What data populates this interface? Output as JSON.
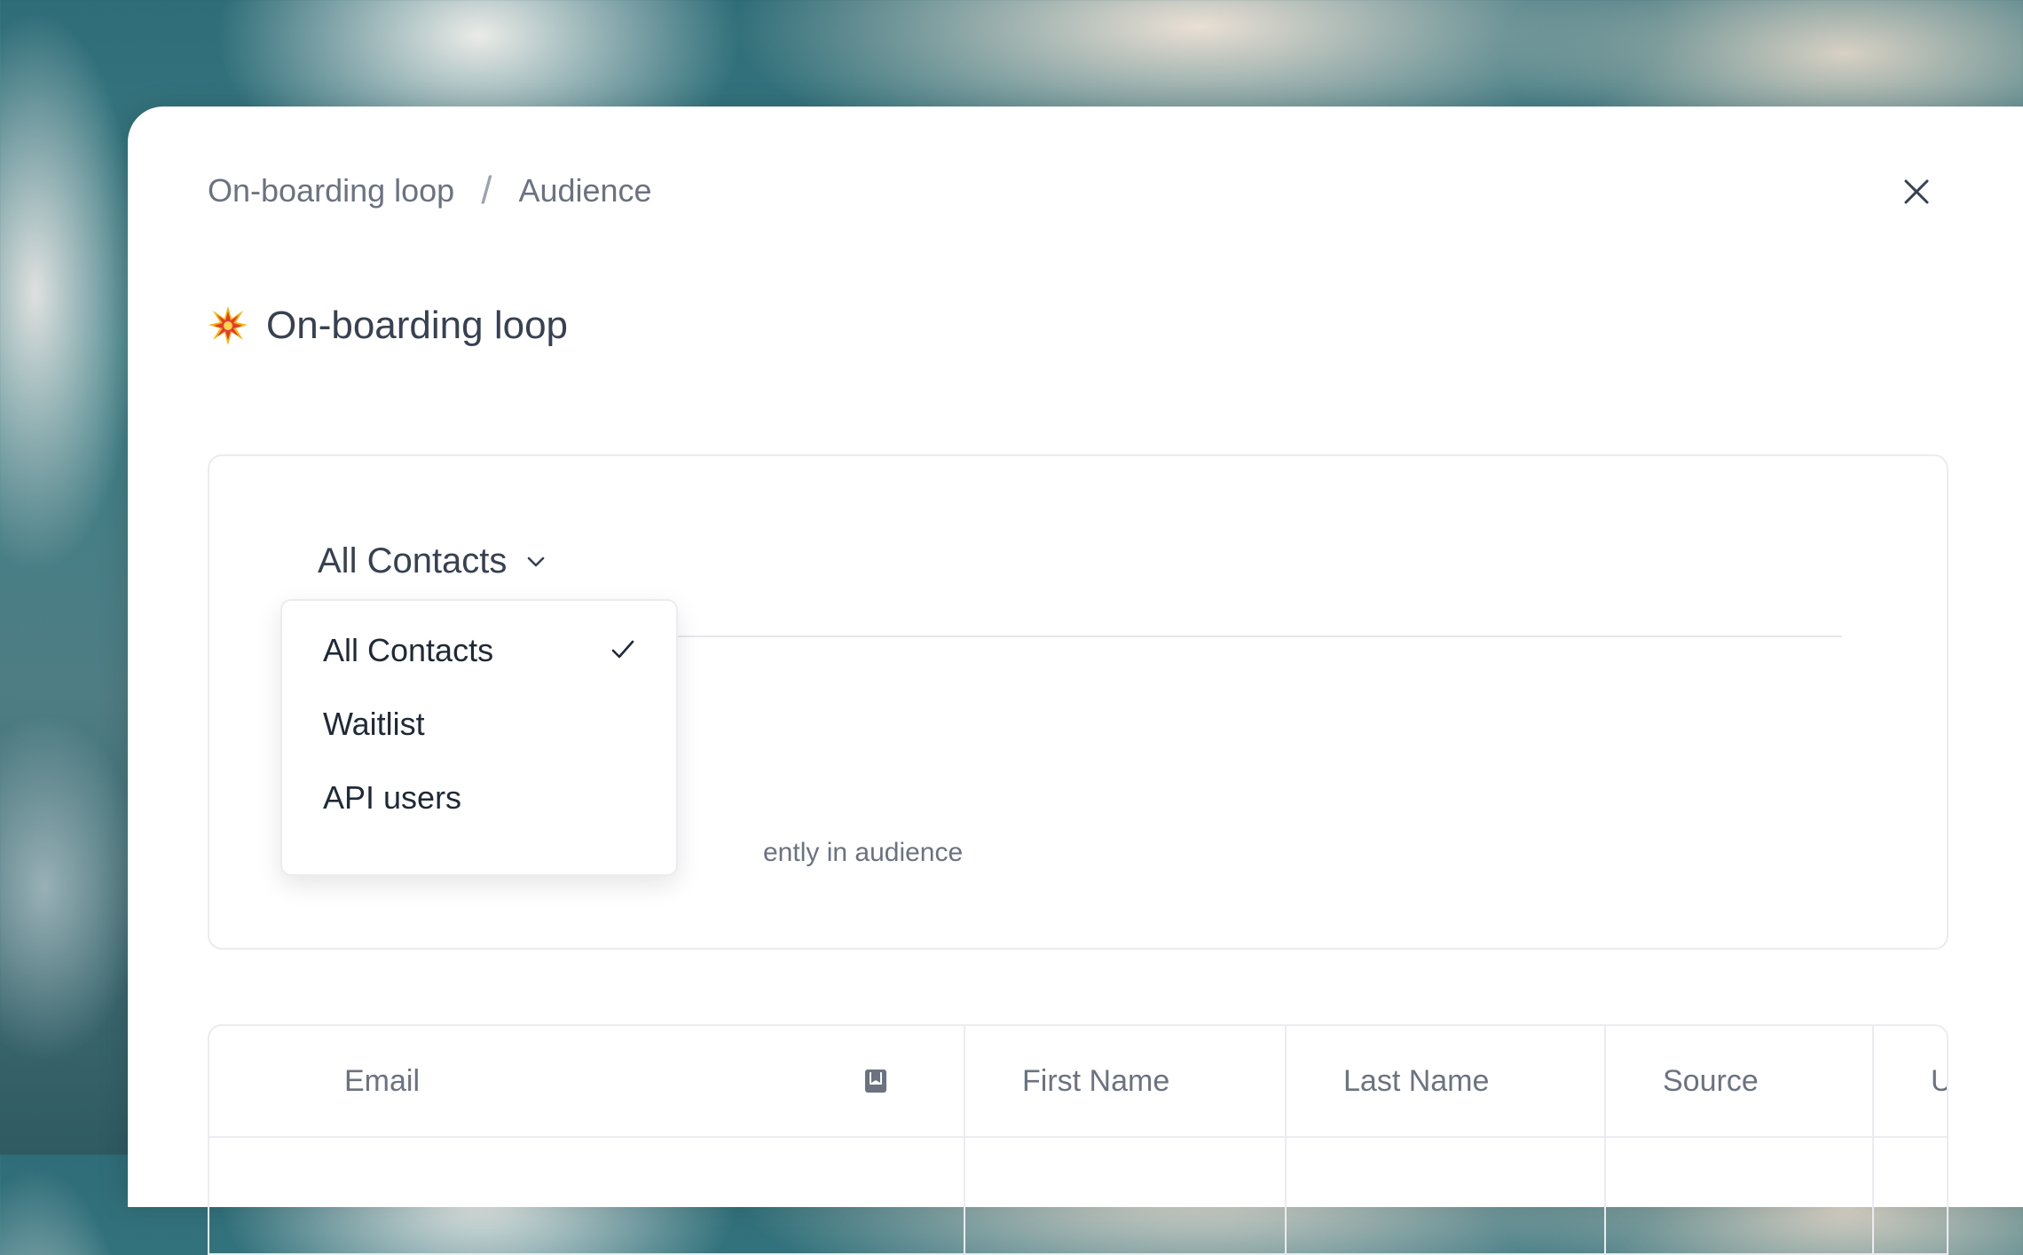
{
  "breadcrumb": {
    "parent": "On-boarding loop",
    "separator": "/",
    "current": "Audience"
  },
  "page": {
    "title": "On-boarding loop",
    "title_icon": "collision-icon"
  },
  "audience": {
    "segment_selected": "All Contacts",
    "note_visible_text": "ently in audience"
  },
  "dropdown": {
    "options": [
      {
        "label": "All Contacts",
        "selected": true
      },
      {
        "label": "Waitlist",
        "selected": false
      },
      {
        "label": "API users",
        "selected": false
      }
    ]
  },
  "table": {
    "columns": [
      "Email",
      "First Name",
      "Last Name",
      "Source",
      "U"
    ]
  },
  "colors": {
    "text_primary": "#374151",
    "text_muted": "#6b7280",
    "border": "#ececf0"
  }
}
